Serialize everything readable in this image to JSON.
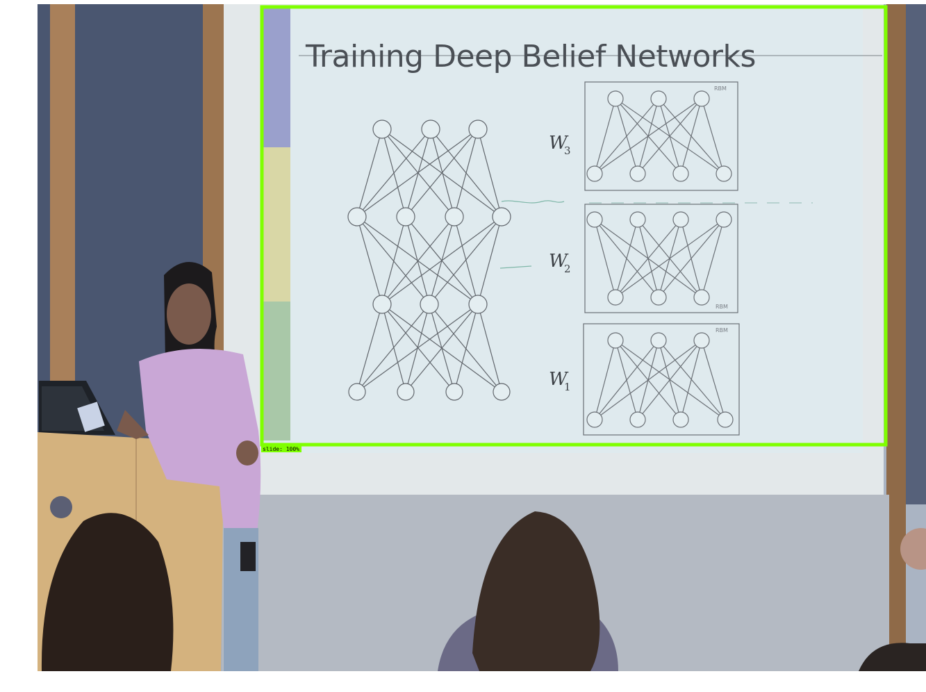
{
  "slide": {
    "title": "Training Deep Belief Networks",
    "weights": [
      {
        "base": "W",
        "sub": "3"
      },
      {
        "base": "W",
        "sub": "2"
      },
      {
        "base": "W",
        "sub": "1"
      }
    ],
    "rbm_tag": "RBM"
  },
  "detection": {
    "label": "slide: 100%",
    "color": "#7fff00"
  }
}
